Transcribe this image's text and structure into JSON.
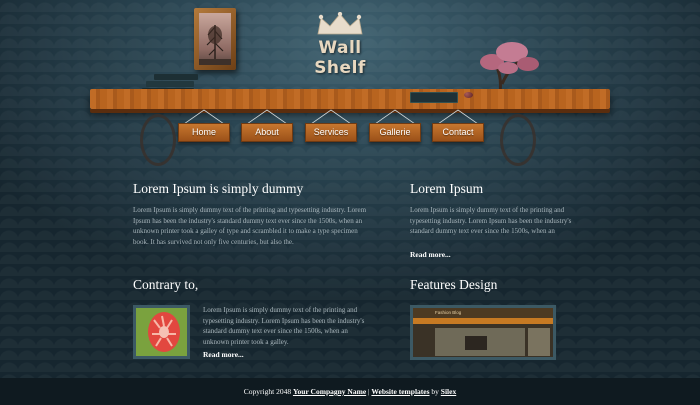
{
  "brand": {
    "title": "Wall Shelf"
  },
  "nav": {
    "items": [
      {
        "label": "Home"
      },
      {
        "label": "About"
      },
      {
        "label": "Services"
      },
      {
        "label": "Gallerie"
      },
      {
        "label": "Contact"
      }
    ]
  },
  "sections": {
    "intro": {
      "heading": "Lorem Ipsum is simply dummy",
      "text": "Lorem Ipsum is simply dummy text of the printing and typesetting industry. Lorem Ipsum has been the industry's standard dummy text ever since the 1500s, when an unknown printer took a galley of type and scrambled it to make a type specimen book. It has survived not only five centuries, but also the."
    },
    "side": {
      "heading": "Lorem Ipsum",
      "text": "Lorem Ipsum is simply dummy text of the printing and typesetting industry. Lorem Ipsum has been the industry's standard dummy text ever since the 1500s, when an",
      "read_more": "Read more..."
    },
    "contrary": {
      "heading": "Contrary to,",
      "text": "Lorem Ipsum is simply dummy text of the printing and typesetting industry. Lorem Ipsum has been the industry's standard dummy text ever since the 1500s, when an unknown printer took a galley.",
      "read_more": "Read more..."
    },
    "features": {
      "heading": "Features Design",
      "preview_title": "Fashion Blog"
    }
  },
  "footer": {
    "copyright": "Copyright 2048",
    "company_link": "Your Compagny Name",
    "separator": "|",
    "templates_link": "Website templates",
    "by": "by",
    "author_link": "Silex"
  },
  "colors": {
    "background": "#2a4552",
    "nav_plate": "#b36624",
    "shelf": "#b8641f",
    "footer": "#0f1a20"
  }
}
